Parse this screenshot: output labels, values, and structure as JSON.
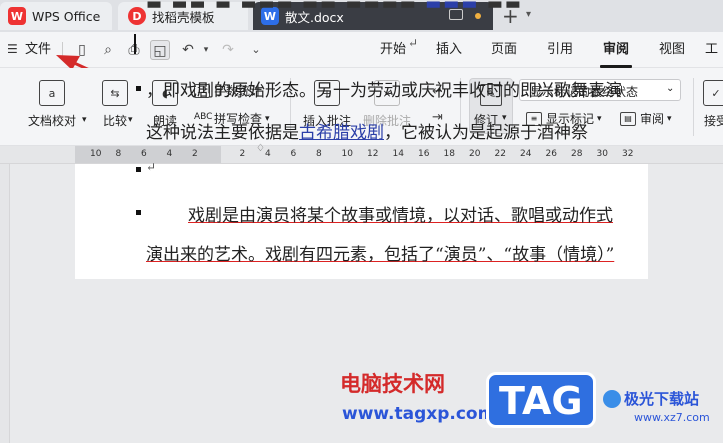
{
  "tabs": {
    "home": "WPS Office",
    "template": "找稻壳模板",
    "document": "散文.docx"
  },
  "menubar": {
    "file_label": "文件",
    "tabs": [
      "开始",
      "插入",
      "页面",
      "引用",
      "审阅",
      "视图",
      "工"
    ],
    "active_tab": "审阅"
  },
  "ribbon": {
    "proofread": "文档校对",
    "compare": "比较",
    "read_aloud": "朗读",
    "word_count": "字数统计",
    "spell_check": "拼写检查",
    "insert_comment": "插入批注",
    "delete_comment": "删除批注",
    "revise": "修订",
    "markup_state": "显示标记的最终状态",
    "show_markup": "显示标记",
    "review": "审阅",
    "accept": "接受"
  },
  "ruler": {
    "labels": [
      "10",
      "8",
      "6",
      "4",
      "2",
      "2",
      "4",
      "6",
      "8",
      "10",
      "12",
      "14",
      "16",
      "18",
      "20",
      "22",
      "24",
      "26",
      "28",
      "30",
      "32"
    ]
  },
  "document": {
    "line1_a": "，即戏剧的原始形态。另一为劳动或庆祝丰收时的即兴歌舞表演",
    "line2_a": "这种说法主要依据是",
    "line2_link": "古希腊戏剧",
    "line2_b": "，它被认为是起源于酒神祭",
    "line3_a": "戏剧是由演员将某个故事或情境，以对话、歌唱或动作式",
    "line4_a": "演出来的艺术。戏剧有四元素，包括了“演员”、“故事（情境）”",
    "return_mark": "↵"
  },
  "watermark": {
    "site_cn": "电脑技术网",
    "site_url": "www.tagxp.com",
    "tag": "TAG",
    "brand": "极光下载站",
    "brand_url": "www.xz7.com"
  },
  "colors": {
    "accent_red": "#d42a2a",
    "active_tab_bg": "#3a3d44",
    "link_blue": "#2b3fa8"
  }
}
